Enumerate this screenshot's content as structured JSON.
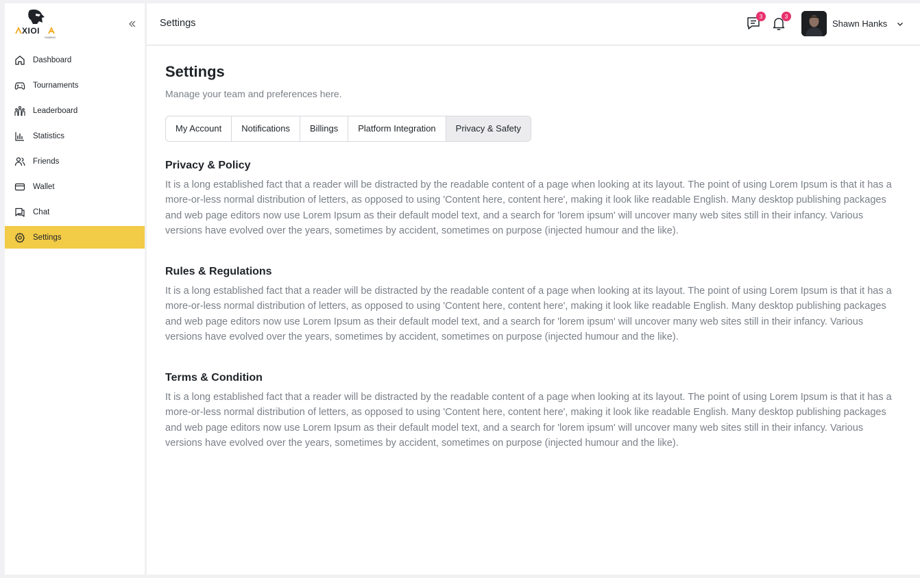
{
  "brand": {
    "logo_text": "AXIOM",
    "logo_sub": "GAMING",
    "accent": "#f2cb47"
  },
  "sidebar": {
    "items": [
      {
        "label": "Dashboard",
        "icon": "home-icon"
      },
      {
        "label": "Tournaments",
        "icon": "gamepad-icon"
      },
      {
        "label": "Leaderboard",
        "icon": "leaderboard-icon"
      },
      {
        "label": "Statistics",
        "icon": "bar-chart-icon"
      },
      {
        "label": "Friends",
        "icon": "users-icon"
      },
      {
        "label": "Wallet",
        "icon": "wallet-icon"
      },
      {
        "label": "Chat",
        "icon": "chat-icon"
      },
      {
        "label": "Settings",
        "icon": "gear-icon",
        "active": true
      }
    ]
  },
  "header": {
    "title": "Settings",
    "messages_count": "3",
    "notifications_count": "3",
    "user_name": "Shawn Hanks"
  },
  "main": {
    "title": "Settings",
    "subtitle": "Manage your team and preferences here.",
    "tabs": [
      {
        "label": "My Account"
      },
      {
        "label": "Notifications"
      },
      {
        "label": "Billings"
      },
      {
        "label": "Platform Integration"
      },
      {
        "label": "Privacy & Safety",
        "active": true
      }
    ],
    "sections": [
      {
        "heading": "Privacy & Policy",
        "body": "It is a long established fact that a reader will be distracted by the readable content of a page when looking at its layout. The point of using Lorem Ipsum is that it has a more-or-less normal distribution of letters, as opposed to using 'Content here, content here', making it look like readable English. Many desktop publishing packages and web page editors now use Lorem Ipsum as their default model text, and a search for 'lorem ipsum' will uncover many web sites still in their infancy. Various versions have evolved over the years, sometimes by accident, sometimes on purpose (injected humour and the like)."
      },
      {
        "heading": "Rules & Regulations",
        "body": "It is a long established fact that a reader will be distracted by the readable content of a page when looking at its layout. The point of using Lorem Ipsum is that it has a more-or-less normal distribution of letters, as opposed to using 'Content here, content here', making it look like readable English. Many desktop publishing packages and web page editors now use Lorem Ipsum as their default model text, and a search for 'lorem ipsum' will uncover many web sites still in their infancy. Various versions have evolved over the years, sometimes by accident, sometimes on purpose (injected humour and the like)."
      },
      {
        "heading": "Terms & Condition",
        "body": "It is a long established fact that a reader will be distracted by the readable content of a page when looking at its layout. The point of using Lorem Ipsum is that it has a more-or-less normal distribution of letters, as opposed to using 'Content here, content here', making it look like readable English. Many desktop publishing packages and web page editors now use Lorem Ipsum as their default model text, and a search for 'lorem ipsum' will uncover many web sites still in their infancy. Various versions have evolved over the years, sometimes by accident, sometimes on purpose (injected humour and the like)."
      }
    ]
  }
}
